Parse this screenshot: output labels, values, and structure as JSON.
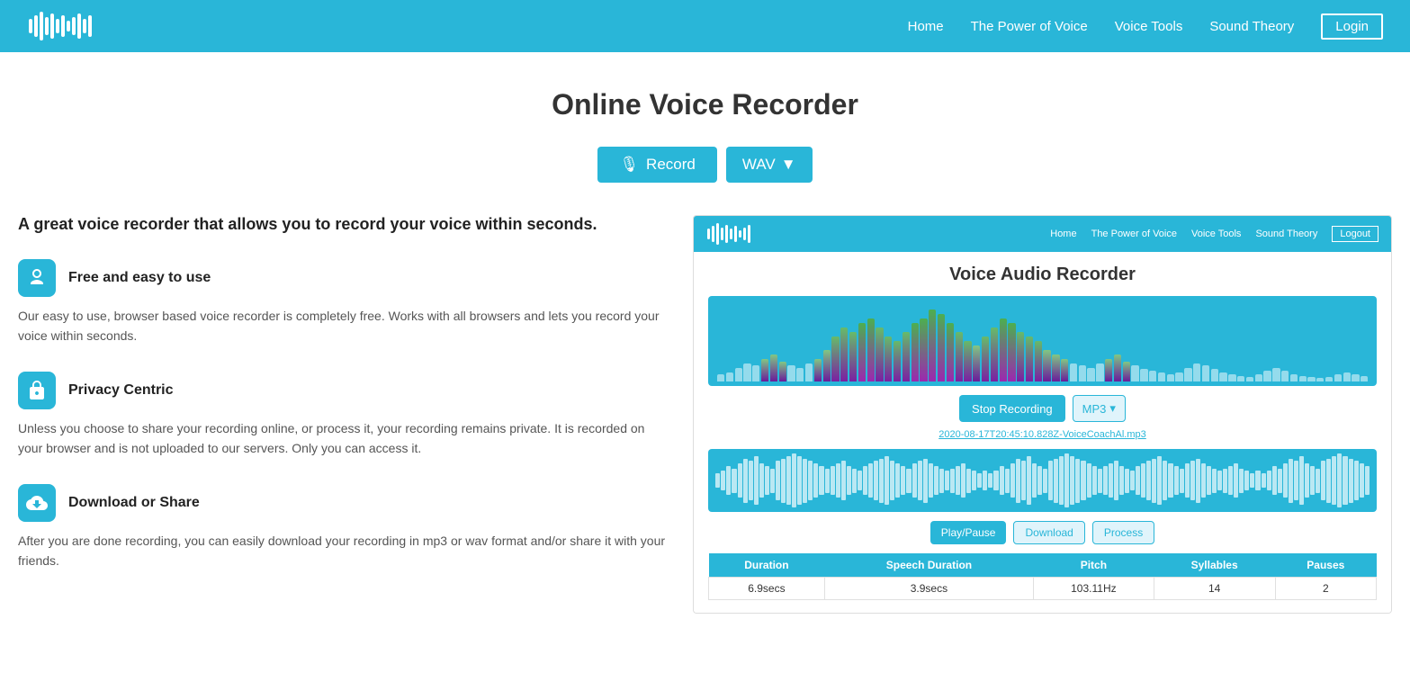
{
  "header": {
    "nav": {
      "home": "Home",
      "power_of_voice": "The Power of Voice",
      "voice_tools": "Voice Tools",
      "sound_theory": "Sound Theory",
      "login": "Login"
    }
  },
  "page": {
    "title": "Online Voice Recorder",
    "record_btn": "Record",
    "wav_btn": "WAV",
    "tagline": "A great voice recorder that allows you to record your voice within seconds.",
    "features": [
      {
        "id": "free",
        "title": "Free and easy to use",
        "text": "Our easy to use, browser based voice recorder is completely free. Works with all browsers and lets you record your voice within seconds."
      },
      {
        "id": "privacy",
        "title": "Privacy Centric",
        "text": "Unless you choose to share your recording online, or process it, your recording remains private. It is recorded on your browser and is not uploaded to our servers. Only you can access it."
      },
      {
        "id": "download",
        "title": "Download or Share",
        "text": "After you are done recording, you can easily download your recording in mp3 or wav format and/or share it with your friends."
      }
    ]
  },
  "mini_panel": {
    "nav": {
      "home": "Home",
      "power_of_voice": "The Power of Voice",
      "voice_tools": "Voice Tools",
      "sound_theory": "Sound Theory",
      "logout": "Logout"
    },
    "title": "Voice Audio Recorder",
    "stop_btn": "Stop Recording",
    "mp3_btn": "MP3",
    "file_name": "2020-08-17T20:45:10.828Z-VoiceCoachAl.mp3",
    "play_btn": "Play/Pause",
    "download_btn": "Download",
    "process_btn": "Process",
    "stats": {
      "headers": [
        "Duration",
        "Speech Duration",
        "Pitch",
        "Syllables",
        "Pauses"
      ],
      "values": [
        "6.9secs",
        "3.9secs",
        "103.11Hz",
        "14",
        "2"
      ]
    }
  },
  "colors": {
    "primary": "#29b6d8",
    "white": "#ffffff",
    "dark": "#222222"
  }
}
